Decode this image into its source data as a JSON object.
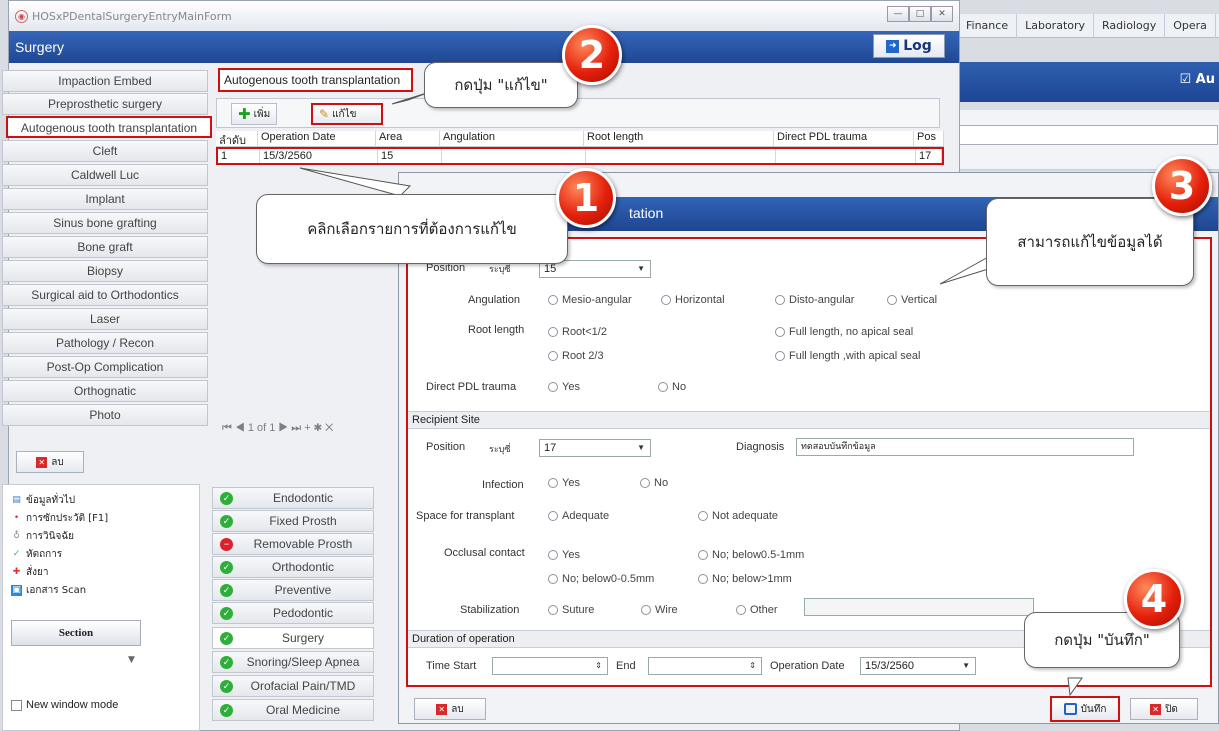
{
  "window": {
    "title": "HOSxPDentalSurgeryEntryMainForm",
    "header": "Surgery",
    "log_label": "Log",
    "log_icon": "logout-icon"
  },
  "background_app": {
    "nav_tabs": [
      "Finance",
      "Laboratory",
      "Radiology",
      "Opera"
    ],
    "checkbox_label": "Au"
  },
  "procedures": [
    "Impaction Embed",
    "Preprosthetic surgery",
    "Autogenous tooth transplantation",
    "Cleft",
    "Caldwell Luc",
    "Implant",
    "Sinus bone grafting",
    "Bone graft",
    "Biopsy",
    "Surgical aid to Orthodontics",
    "Laser",
    "Pathology / Recon",
    "Post-Op Complication",
    "Orthognatic",
    "Photo"
  ],
  "grid": {
    "tab_label": "Autogenous tooth transplantation",
    "toolbar": {
      "add_label": "เพิ่ม",
      "edit_label": "แก้ไข"
    },
    "columns": [
      "ลำดับ",
      "Operation Date",
      "Area",
      "Angulation",
      "Root length",
      "Direct PDL trauma",
      "Pos"
    ],
    "rows": [
      {
        "no": "1",
        "date": "15/3/2560",
        "area": "15",
        "angulation": "",
        "root": "",
        "pdl": "",
        "pos": "17"
      }
    ],
    "pager": "⏮ ◀ 1 of 1 ▶ ⏭ + ✱ ✕"
  },
  "left_delete_label": "ลบ",
  "tree": [
    {
      "label": "ข้อมูลทั่วไป",
      "icon": "document-icon",
      "color": "#3a7bd5"
    },
    {
      "label": "การซักประวัติ [F1]",
      "icon": "history-icon",
      "color": "#d33"
    },
    {
      "label": "การวินิจฉัย",
      "icon": "stethoscope-icon",
      "color": "#888"
    },
    {
      "label": "หัตถการ",
      "icon": "procedure-icon",
      "color": "#5a8"
    },
    {
      "label": "สั่งยา",
      "icon": "medicine-icon",
      "color": "#d33"
    },
    {
      "label": "เอกสาร Scan",
      "icon": "scan-icon",
      "color": "#2b8ad8"
    }
  ],
  "section_label": "Section",
  "new_window_label": "New window mode",
  "specialties": [
    {
      "label": "Endodontic",
      "status": "ok"
    },
    {
      "label": "Fixed Prosth",
      "status": "ok"
    },
    {
      "label": "Removable Prosth",
      "status": "blocked"
    },
    {
      "label": "Orthodontic",
      "status": "ok"
    },
    {
      "label": "Preventive",
      "status": "ok"
    },
    {
      "label": "Pedodontic",
      "status": "ok"
    },
    {
      "label": "Surgery",
      "status": "ok"
    },
    {
      "label": "Snoring/Sleep Apnea",
      "status": "ok"
    },
    {
      "label": "Orofacial Pain/TMD",
      "status": "ok"
    },
    {
      "label": "Oral Medicine",
      "status": "ok"
    }
  ],
  "dialog": {
    "title": "tation",
    "donor_position": {
      "label": "Position",
      "sub": "ระบุซี่",
      "value": "15"
    },
    "angulation": {
      "label": "Angulation",
      "options": [
        "Mesio-angular",
        "Horizontal",
        "Disto-angular",
        "Vertical"
      ]
    },
    "root_length": {
      "label": "Root length",
      "options": [
        "Root<1/2",
        "Full length, no apical seal",
        "Root 2/3",
        "Full length ,with apical seal"
      ]
    },
    "pdl": {
      "label": "Direct PDL trauma",
      "options": [
        "Yes",
        "No"
      ]
    },
    "recipient_section": "Recipient Site",
    "recipient_position": {
      "label": "Position",
      "sub": "ระบุซี่",
      "value": "17"
    },
    "diagnosis": {
      "label": "Diagnosis",
      "value": "ทดสอบบันทึกข้อมูล"
    },
    "infection": {
      "label": "Infection",
      "options": [
        "Yes",
        "No"
      ]
    },
    "space": {
      "label": "Space for transplant",
      "options": [
        "Adequate",
        "Not adequate"
      ]
    },
    "occlusal": {
      "label": "Occlusal contact",
      "options": [
        "Yes",
        "No; below0.5-1mm",
        "No; below0-0.5mm",
        "No; below>1mm"
      ]
    },
    "stabilization": {
      "label": "Stabilization",
      "options": [
        "Suture",
        "Wire",
        "Other"
      ]
    },
    "duration_section": "Duration of operation",
    "time_start_label": "Time Start",
    "end_label": "End",
    "op_date": {
      "label": "Operation Date",
      "value": "15/3/2560"
    },
    "delete_label": "ลบ",
    "save_label": "บันทึก",
    "close_label": "ปิด"
  },
  "callouts": {
    "c1": {
      "num": "1",
      "text": "คลิกเลือกรายการที่ต้องการแก้ไข"
    },
    "c2": {
      "num": "2",
      "text": "กดปุ่ม \"แก้ไข\""
    },
    "c3": {
      "num": "3",
      "text": "สามารถแก้ไขข้อมูลได้"
    },
    "c4": {
      "num": "4",
      "text": "กดปุ่ม \"บันทึก\""
    }
  },
  "colors": {
    "header_blue": "#1f4793",
    "highlight_red": "#d01010",
    "ok_green": "#2fae3a",
    "blocked_red": "#d8222c"
  }
}
